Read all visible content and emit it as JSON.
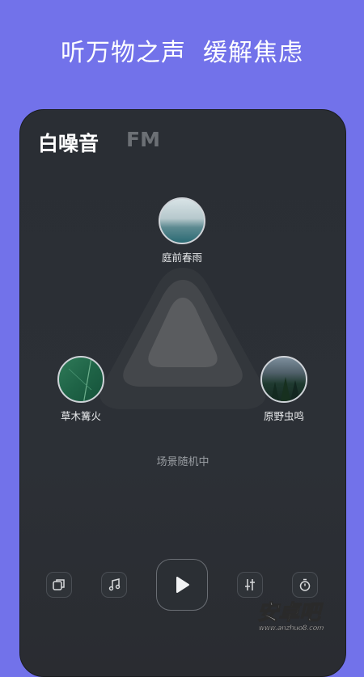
{
  "banner": {
    "headline": "听万物之声  缓解焦虑"
  },
  "tabs": [
    {
      "label": "白噪音",
      "active": true
    },
    {
      "label": "FM",
      "active": false
    }
  ],
  "scenes": [
    {
      "label": "庭前春雨",
      "icon": "rain-lake-thumbnail"
    },
    {
      "label": "草木篝火",
      "icon": "leaf-thumbnail"
    },
    {
      "label": "原野虫鸣",
      "icon": "forest-thumbnail"
    }
  ],
  "status": {
    "text": "场景随机中"
  },
  "controls": {
    "items": [
      {
        "name": "copy-icon"
      },
      {
        "name": "music-note-icon"
      },
      {
        "name": "play-icon"
      },
      {
        "name": "equalizer-icon"
      },
      {
        "name": "timer-icon"
      }
    ]
  },
  "watermark": {
    "text": "安卓吧",
    "sub": "www.anzhuo8.com"
  },
  "colors": {
    "background": "#7272ea",
    "panel": "#2b2f35",
    "text": "#ffffff"
  }
}
